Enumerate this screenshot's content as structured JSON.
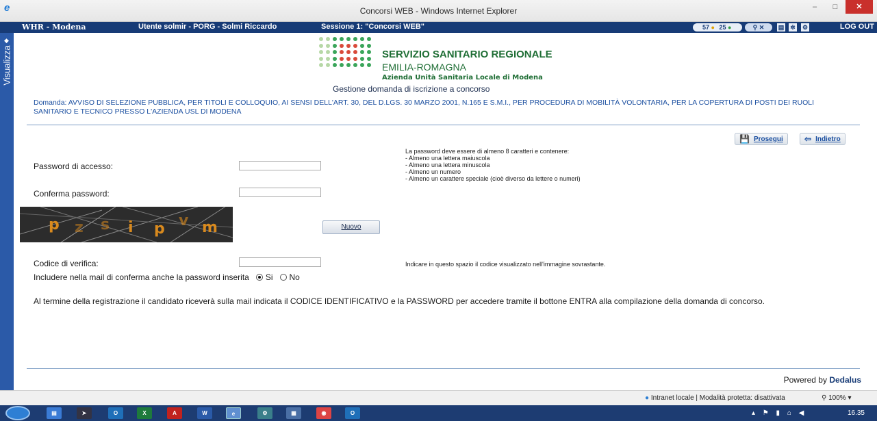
{
  "window": {
    "title": "Concorsi WEB - Windows Internet Explorer",
    "minimize": "–",
    "maximize": "□",
    "close": "✕"
  },
  "appbar": {
    "site": "WHR - Modena",
    "user": "Utente solmir - PORG - Solmi Riccardo",
    "session": "Sessione 1: \"Concorsi WEB\"",
    "counter1": "57",
    "counter2": "25",
    "logout": "LOG OUT"
  },
  "sidebar": {
    "label": "Visualizza"
  },
  "header": {
    "org_line1": "SERVIZIO SANITARIO REGIONALE",
    "org_line2": "EMILIA-ROMAGNA",
    "org_line3": "Azienda Unità Sanitaria Locale di Modena",
    "subtitle": "Gestione domanda di iscrizione a concorso"
  },
  "domanda": "Domanda: AVVISO DI SELEZIONE PUBBLICA, PER TITOLI E COLLOQUIO, AI SENSI DELL'ART. 30, DEL D.LGS. 30 MARZO 2001, N.165 E S.M.I., PER PROCEDURA DI MOBILITÀ VOLONTARIA, PER LA COPERTURA DI POSTI DEI RUOLI SANITARIO E TECNICO PRESSO L'AZIENDA USL DI MODENA",
  "actions": {
    "prosegui": "Prosegui",
    "indietro": "Indietro"
  },
  "form": {
    "password_label": "Password di accesso:",
    "password_value": "",
    "confirm_label": "Conferma password:",
    "confirm_value": "",
    "password_rules": [
      "La password deve essere di almeno 8 caratteri e contenere:",
      "- Almeno una lettera maiuscola",
      "- Almeno una lettera minuscola",
      "- Almeno un numero",
      "- Almeno un carattere speciale (cioè diverso da lettere o numeri)"
    ],
    "captcha_chars": [
      "p",
      "z",
      "s",
      "i",
      "p",
      "v",
      "m"
    ],
    "nuovo": "Nuovo",
    "code_label": "Codice di verifica:",
    "code_value": "",
    "code_hint": "Indicare in questo spazio il codice visualizzato nell'immagine sovrastante.",
    "include_label": "Includere nella mail di conferma anche la password inserita",
    "opt_yes": "Si",
    "opt_no": "No",
    "selected": "Si"
  },
  "note": "Al termine della registrazione il candidato riceverà sulla mail indicata il CODICE IDENTIFICATIVO e la PASSWORD per accedere tramite il bottone ENTRA alla compilazione della domanda di concorso.",
  "footer": {
    "powered_prefix": "Powered by",
    "brand": "Dedalus"
  },
  "statusbar": {
    "zone": "Intranet locale | Modalità protetta: disattivata",
    "zoom": "100%"
  },
  "taskbar": {
    "clock": "16.35"
  }
}
